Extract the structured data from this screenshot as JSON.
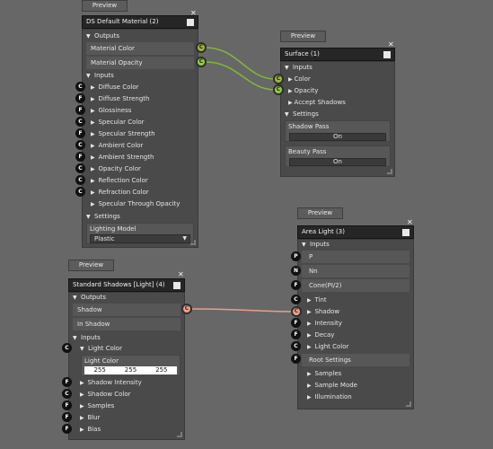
{
  "material_node": {
    "preview": "Preview",
    "title": "DS Default Material (2)",
    "outputs_header": "Outputs",
    "outputs": [
      {
        "label": "Material Color",
        "port": "C"
      },
      {
        "label": "Material Opacity",
        "port": "C"
      }
    ],
    "inputs_header": "Inputs",
    "inputs": [
      {
        "label": "Diffuse Color",
        "port": "C"
      },
      {
        "label": "Diffuse Strength",
        "port": "F"
      },
      {
        "label": "Glossiness",
        "port": "F"
      },
      {
        "label": "Specular Color",
        "port": "C"
      },
      {
        "label": "Specular Strength",
        "port": "F"
      },
      {
        "label": "Ambient Color",
        "port": "C"
      },
      {
        "label": "Ambient Strength",
        "port": "F"
      },
      {
        "label": "Opacity Color",
        "port": "C"
      },
      {
        "label": "Reflection Color",
        "port": "C"
      },
      {
        "label": "Refraction Color",
        "port": "C"
      },
      {
        "label": "Specular Through Opacity",
        "port": ""
      }
    ],
    "settings_header": "Settings",
    "lighting_model_label": "Lighting Model",
    "lighting_model_value": "Plastic"
  },
  "surface_node": {
    "preview": "Preview",
    "title": "Surface (1)",
    "inputs_header": "Inputs",
    "inputs": [
      {
        "label": "Color",
        "port": "C"
      },
      {
        "label": "Opacity",
        "port": "C"
      },
      {
        "label": "Accept Shadows",
        "port": ""
      }
    ],
    "settings_header": "Settings",
    "shadow_pass_label": "Shadow Pass",
    "shadow_pass_value": "On",
    "beauty_pass_label": "Beauty Pass",
    "beauty_pass_value": "On"
  },
  "shadows_node": {
    "preview": "Preview",
    "title": "Standard Shadows [Light] (4)",
    "outputs_header": "Outputs",
    "outputs": [
      {
        "label": "Shadow",
        "port": "C"
      },
      {
        "label": "In Shadow",
        "port": ""
      }
    ],
    "inputs_header": "Inputs",
    "light_color_header": "Light Color",
    "light_color_label": "Light Color",
    "light_color_values": [
      "255",
      "255",
      "255"
    ],
    "inputs": [
      {
        "label": "Shadow Intensity",
        "port": "F"
      },
      {
        "label": "Shadow Color",
        "port": "C"
      },
      {
        "label": "Samples",
        "port": "F"
      },
      {
        "label": "Blur",
        "port": "F"
      },
      {
        "label": "Bias",
        "port": "F"
      }
    ]
  },
  "area_light_node": {
    "preview": "Preview",
    "title": "Area Light (3)",
    "inputs_header": "Inputs",
    "top_inputs": [
      {
        "label": "P",
        "port": "P"
      },
      {
        "label": "Nn",
        "port": "N"
      },
      {
        "label": "Cone(PI/2)",
        "port": "F"
      }
    ],
    "inputs": [
      {
        "label": "Tint",
        "port": "C"
      },
      {
        "label": "Shadow",
        "port": "C"
      },
      {
        "label": "Intensity",
        "port": "F"
      },
      {
        "label": "Decay",
        "port": "F"
      },
      {
        "label": "Light Color",
        "port": "C"
      }
    ],
    "root_settings_label": "Root Settings",
    "root_settings_port": "F",
    "settings": [
      "Samples",
      "Sample Mode",
      "Illumination"
    ]
  },
  "colors": {
    "canvas": "#676767",
    "wire_green": "#7fb83a",
    "wire_salmon": "#e6a08c"
  }
}
